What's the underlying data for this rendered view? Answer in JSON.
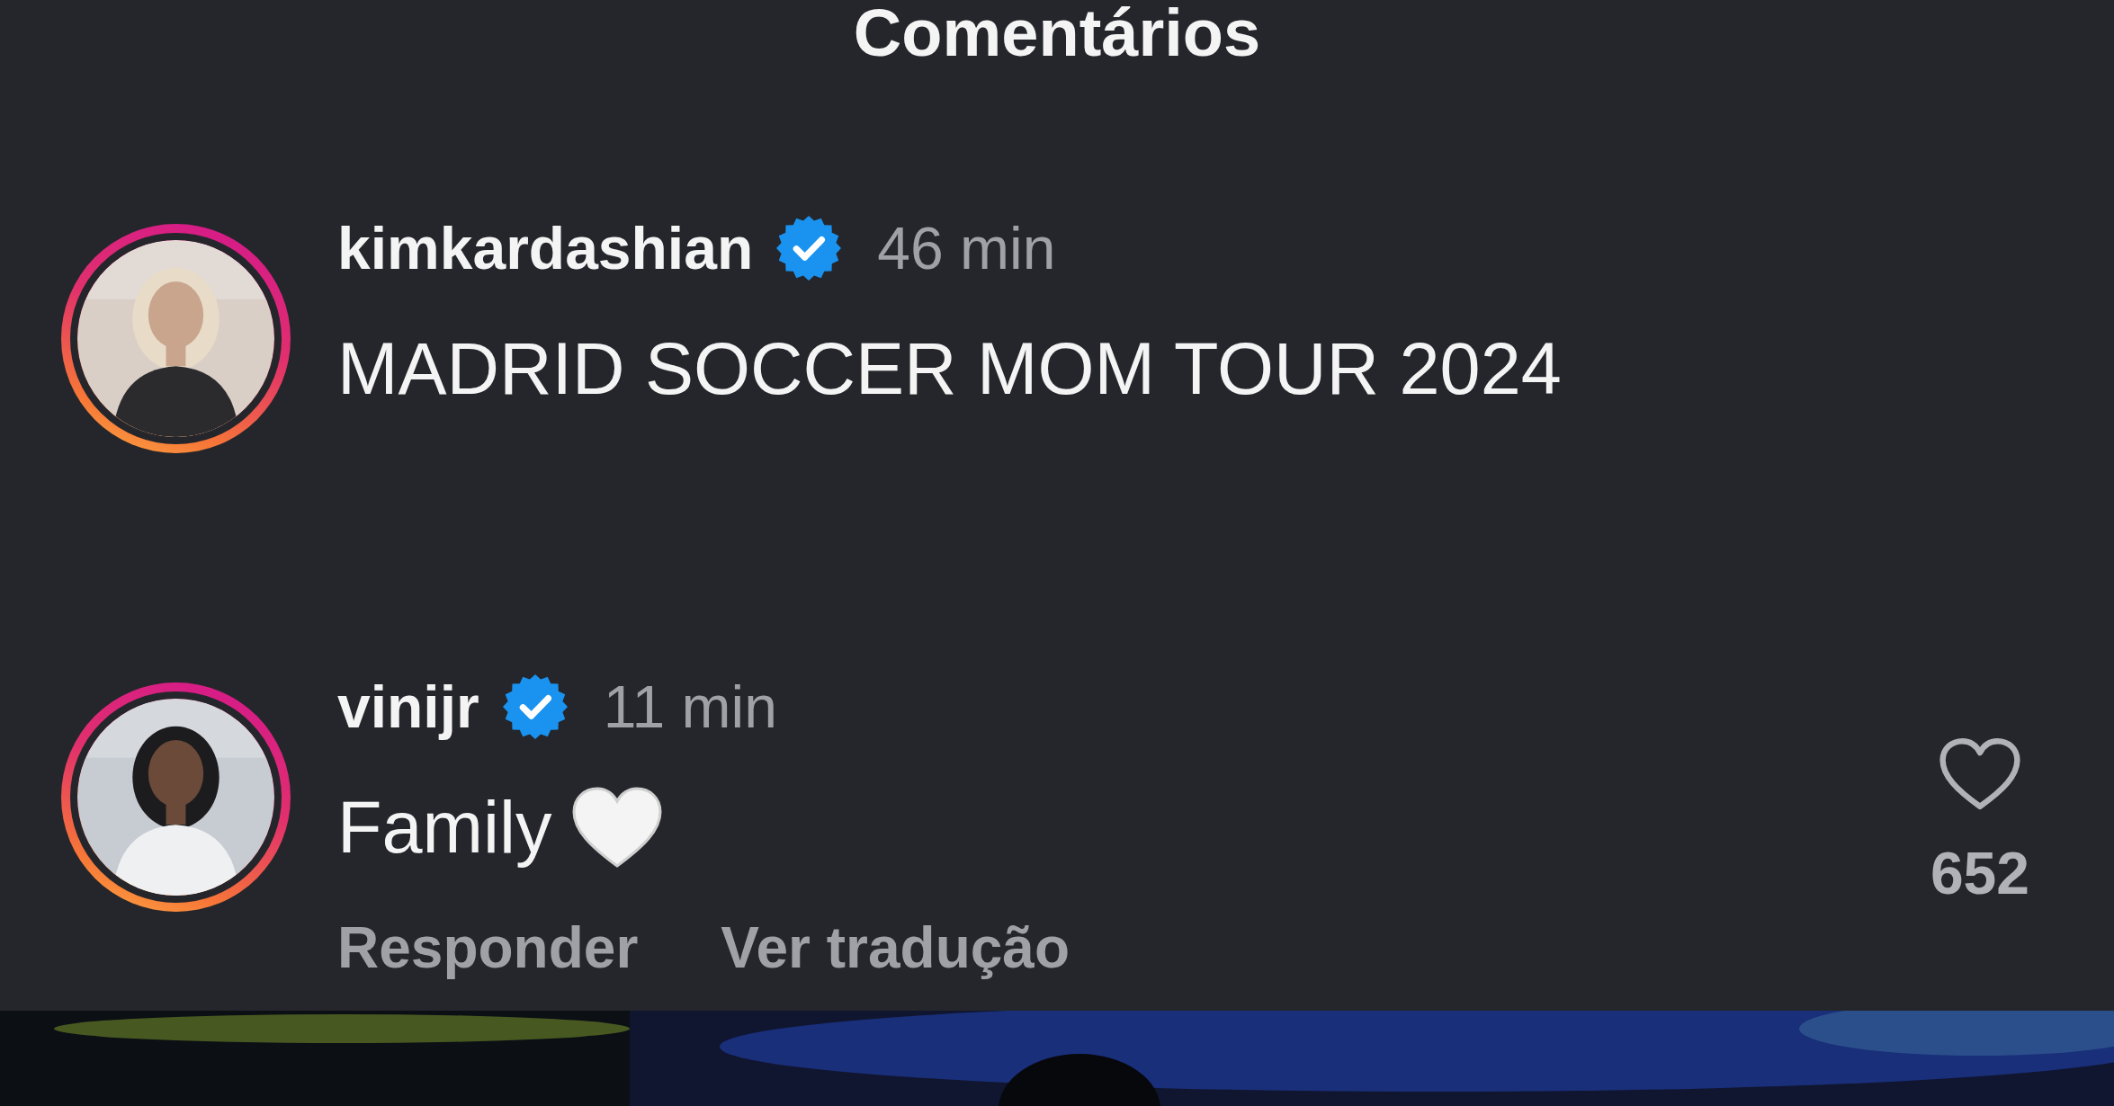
{
  "header": {
    "title": "Comentários"
  },
  "comments": [
    {
      "story_ring": true,
      "username": "kimkardashian",
      "verified": true,
      "time": "46 min",
      "text": "MADRID SOCCER MOM TOUR 2024"
    },
    {
      "story_ring": true,
      "username": "vinijr",
      "verified": true,
      "time": "11 min",
      "text": "Family",
      "heart_emoji": true,
      "actions": [
        "Responder",
        "Ver tradução"
      ],
      "likes": "652"
    }
  ]
}
